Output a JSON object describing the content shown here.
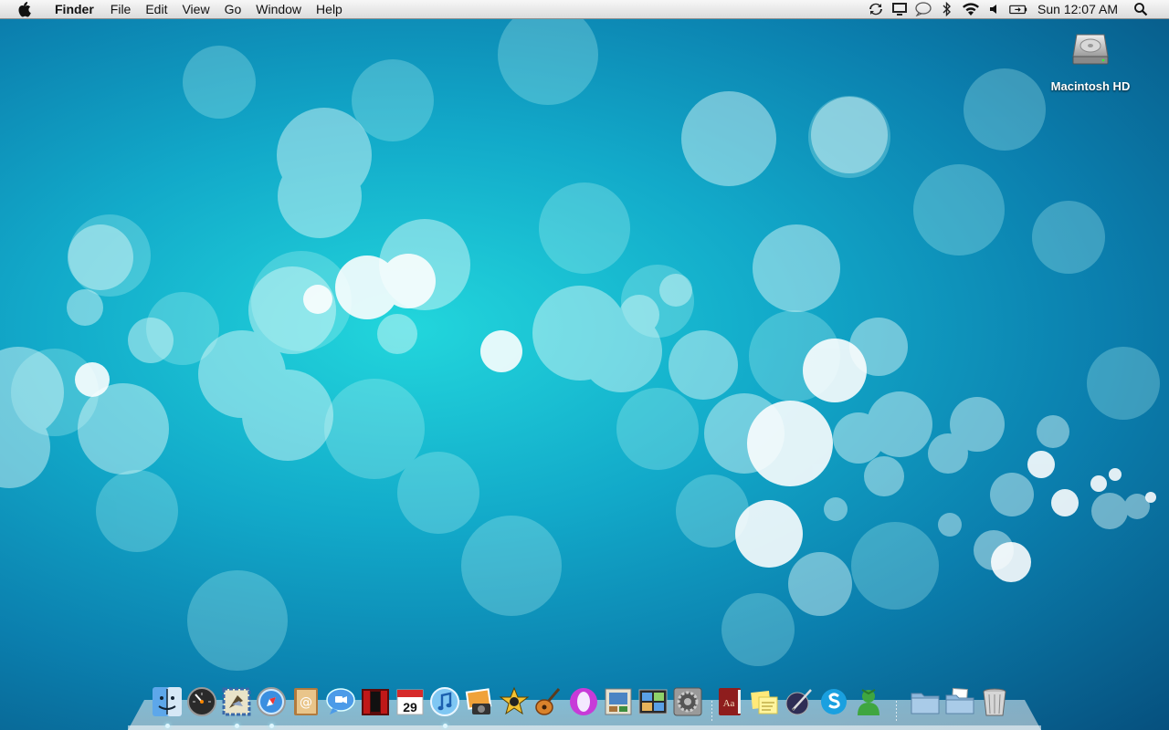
{
  "menubar": {
    "app_name": "Finder",
    "menus": [
      "File",
      "Edit",
      "View",
      "Go",
      "Window",
      "Help"
    ],
    "clock": "Sun 12:07 AM",
    "status_icons": [
      "sync-icon",
      "display-icon",
      "ichat-icon",
      "bluetooth-icon",
      "wifi-icon",
      "volume-icon",
      "battery-icon",
      "spotlight-icon"
    ]
  },
  "desktop": {
    "drive_label": "Macintosh HD"
  },
  "dock": {
    "apps": [
      {
        "name": "finder-icon",
        "running": true
      },
      {
        "name": "dashboard-icon",
        "running": false
      },
      {
        "name": "mail-icon",
        "running": true
      },
      {
        "name": "safari-icon",
        "running": true
      },
      {
        "name": "address-book-icon",
        "running": false
      },
      {
        "name": "ichat-icon",
        "running": false
      },
      {
        "name": "front-row-icon",
        "running": false
      },
      {
        "name": "ical-icon",
        "running": false,
        "text": "29"
      },
      {
        "name": "itunes-icon",
        "running": true
      },
      {
        "name": "iphoto-icon",
        "running": false
      },
      {
        "name": "imovie-icon",
        "running": false
      },
      {
        "name": "garageband-icon",
        "running": false
      },
      {
        "name": "opera-icon",
        "running": false
      },
      {
        "name": "preview-icon",
        "running": false
      },
      {
        "name": "spaces-icon",
        "running": false
      },
      {
        "name": "system-preferences-icon",
        "running": false
      },
      {
        "name": "dictionary-icon",
        "running": false,
        "text": "Aa"
      },
      {
        "name": "stickies-icon",
        "running": false
      },
      {
        "name": "script-editor-icon",
        "running": false
      },
      {
        "name": "skype-icon",
        "running": false
      },
      {
        "name": "user-icon",
        "running": false
      }
    ],
    "stacks": [
      "applications-folder-icon",
      "documents-stack-icon",
      "trash-icon"
    ]
  }
}
